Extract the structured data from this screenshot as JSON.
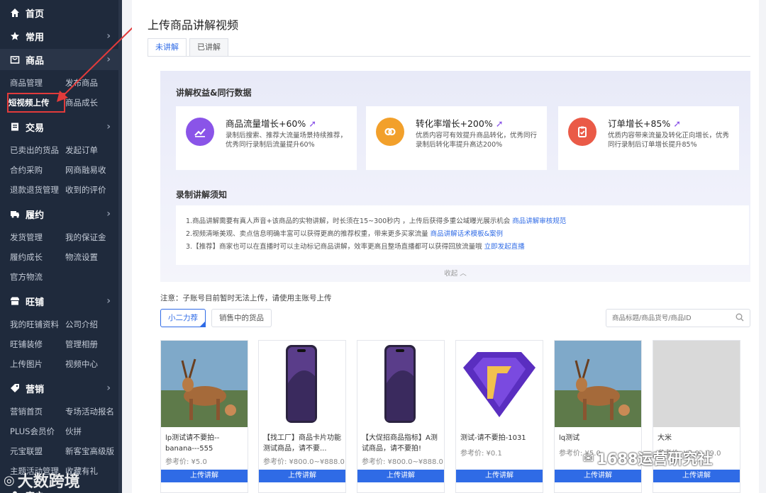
{
  "sidebar": {
    "sections": [
      {
        "label": "首页",
        "icon": "home-icon",
        "items": []
      },
      {
        "label": "常用",
        "icon": "star-icon",
        "items": []
      },
      {
        "label": "商品",
        "icon": "bag-icon",
        "items": [
          "商品管理",
          "发布商品",
          "短视频上传",
          "商品成长"
        ]
      },
      {
        "label": "交易",
        "icon": "book-icon",
        "items": [
          "已卖出的货品",
          "发起订单",
          "合约采购",
          "网商融易收",
          "退款退货管理",
          "收到的评价"
        ]
      },
      {
        "label": "履约",
        "icon": "truck-icon",
        "items": [
          "发货管理",
          "我的保证金",
          "履约成长",
          "物流设置",
          "官方物流"
        ]
      },
      {
        "label": "旺铺",
        "icon": "shop-icon",
        "items": [
          "我的旺铺资料",
          "公司介绍",
          "旺铺装修",
          "管理相册",
          "上传图片",
          "视频中心"
        ]
      },
      {
        "label": "营销",
        "icon": "tag-icon",
        "items": [
          "营销首页",
          "专场活动报名",
          "PLUS会员价",
          "伙拼",
          "元宝联盟",
          "新客宝高级版",
          "主题活动管理",
          "收藏有礼"
        ]
      },
      {
        "label": "客户",
        "icon": "user-icon",
        "items": []
      }
    ]
  },
  "main": {
    "title": "上传商品讲解视频",
    "tabs": [
      "未讲解",
      "已讲解"
    ],
    "benefits_title": "讲解权益&同行数据",
    "benefits": [
      {
        "title": "商品流量增长+60%",
        "desc": "录制后搜索、推荐大流量场景持续推荐，优秀同行录制后流量提升60%",
        "color": "#8a54e8",
        "icon": "chart-up-icon"
      },
      {
        "title": "转化率增长+200%",
        "desc": "优质内容可有效提升商品转化，优秀同行录制后转化率提升高达200%",
        "color": "#f2a02b",
        "icon": "exchange-icon"
      },
      {
        "title": "订单增长+85%",
        "desc": "优质内容带来流量及转化正向增长，优秀同行录制后订单增长提升85%",
        "color": "#ea5a47",
        "icon": "clipboard-icon"
      }
    ],
    "rules_title": "录制讲解须知",
    "rules": [
      {
        "text": "1.商品讲解需要有真人声音+该商品的实物讲解，时长须在15~300秒内 ，上传后获得多重公域曝光展示机会 ",
        "link": "商品讲解审核规范"
      },
      {
        "text": "2.视频清晰美观、卖点信息明确丰富可以获得更高的推荐权重，带来更多买家流量 ",
        "link": "商品讲解话术模板&案例"
      },
      {
        "text": "3.【推荐】商家也可以在直播时可以主动标记商品讲解，效率更高且整场直播都可以获得回放流量哦 ",
        "link": "立即发起直播"
      }
    ],
    "collapse_label": "收起 ︿",
    "notice": "注意：子账号目前暂时无法上传，请使用主账号上传",
    "filters": [
      "小二力荐",
      "销售中的货品"
    ],
    "search_placeholder": "商品标题/商品货号/商品ID",
    "products": [
      {
        "name": "lp测试请不要拍--banana---555",
        "price": "参考价: ¥5.0",
        "button": "上传讲解",
        "img": "deer"
      },
      {
        "name": "【找工厂】商品卡片功能测试商品，请不要...",
        "price": "参考价: ¥800.0~¥888.0",
        "button": "上传讲解",
        "img": "phone"
      },
      {
        "name": "【大促招商品指标】A测试商品，请不要拍!",
        "price": "参考价: ¥800.0~¥888.0",
        "button": "上传讲解",
        "img": "phone"
      },
      {
        "name": "测试-请不要拍-1031",
        "price": "参考价: ¥0.1",
        "button": "上传讲解",
        "img": "badge"
      },
      {
        "name": "lq测试",
        "price": "参考价: ¥5.0",
        "button": "上传讲解",
        "img": "deer"
      },
      {
        "name": "大米",
        "price": "参考价: ¥5.0~¥9.0",
        "button": "上传讲解",
        "img": "blank"
      }
    ]
  },
  "watermarks": [
    "大数跨境",
    "1688运营研究社"
  ]
}
